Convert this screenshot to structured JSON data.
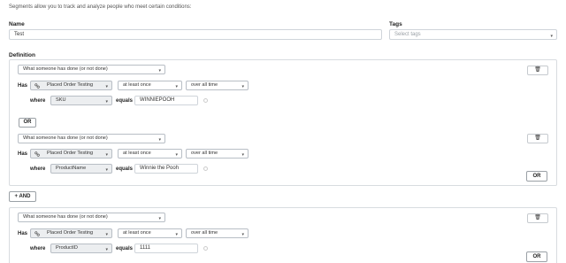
{
  "intro": "Segments allow you to track and analyze people who meet certain conditions:",
  "name": {
    "label": "Name",
    "value": "Test"
  },
  "tags": {
    "label": "Tags",
    "placeholder": "Select tags"
  },
  "definition_label": "Definition",
  "has_label": "Has",
  "where_label": "where",
  "equals_label": "equals",
  "or_label": "OR",
  "and_label": "+ AND",
  "conditions": [
    {
      "type": "What someone has done (or not done)",
      "event": "Placed Order Testing",
      "frequency": "at least once",
      "period": "over all time",
      "property": "SKU",
      "value": "WINNIEPOOH"
    },
    {
      "type": "What someone has done (or not done)",
      "event": "Placed Order Testing",
      "frequency": "at least once",
      "period": "over all time",
      "property": "ProductName",
      "value": "Winnie the Pooh"
    },
    {
      "type": "What someone has done (or not done)",
      "event": "Placed Order Testing",
      "frequency": "at least once",
      "period": "over all time",
      "property": "ProductID",
      "value": "1111"
    }
  ]
}
